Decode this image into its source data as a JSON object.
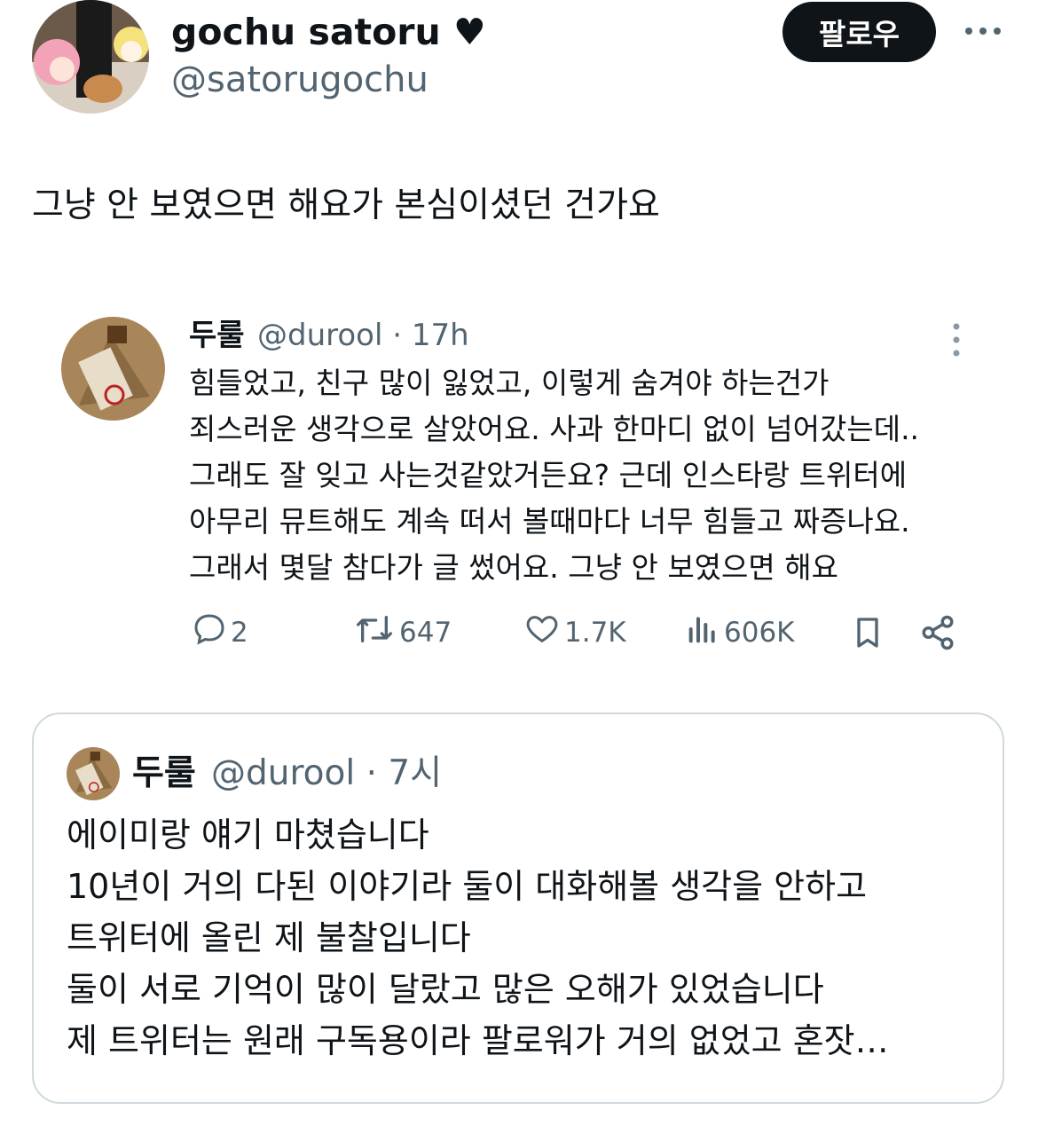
{
  "author": {
    "display_name": "gochu satoru ♥",
    "handle": "@satorugochu",
    "follow_label": "팔로우"
  },
  "tweet": {
    "text": "그냥 안 보였으면 해요가 본심이셨던 건가요"
  },
  "embedded_tweet": {
    "name": "두룰",
    "handle_time": "@durool · 17h",
    "lines": [
      "힘들었고, 친구 많이 잃었고, 이렇게 숨겨야 하는건가",
      "죄스러운 생각으로 살았어요. 사과 한마디 없이 넘어갔는데..",
      "그래도 잘 잊고 사는것같았거든요? 근데 인스타랑 트위터에",
      "아무리 뮤트해도 계속 떠서 볼때마다 너무 힘들고 짜증나요.",
      "그래서 몇달 참다가 글 썼어요. 그냥 안 보였으면 해요"
    ],
    "actions": {
      "replies": "2",
      "retweets": "647",
      "likes": "1.7K",
      "views": "606K"
    },
    "icons": [
      "reply-icon",
      "retweet-icon",
      "like-icon",
      "views-icon",
      "bookmark-icon",
      "share-icon"
    ]
  },
  "quoted_tweet": {
    "name": "두룰",
    "handle_time": "@durool · 7시",
    "lines": [
      "에이미랑 얘기 마쳤습니다",
      "10년이 거의 다된 이야기라 둘이 대화해볼 생각을 안하고",
      "트위터에 올린 제 불찰입니다",
      "둘이 서로 기억이 많이 달랐고 많은 오해가 있었습니다",
      "제 트위터는 원래 구독용이라 팔로워가 거의 없었고 혼잣…"
    ]
  },
  "colors": {
    "text": "#0f1419",
    "secondary": "#536471",
    "border": "#cfd9de",
    "button_bg": "#0f1419"
  }
}
